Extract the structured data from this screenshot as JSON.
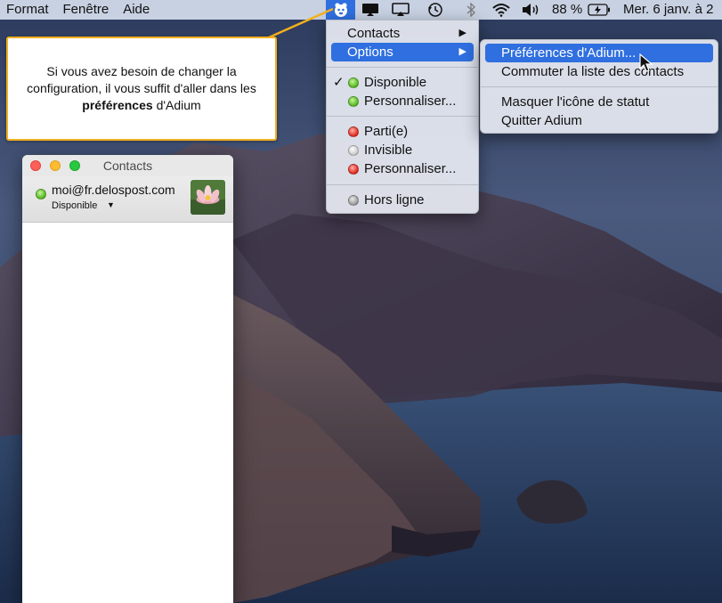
{
  "menubar": {
    "left_items": [
      "Format",
      "Fenêtre",
      "Aide"
    ],
    "battery": "88 %",
    "clock": "Mer. 6 janv. à 2",
    "icons": [
      "adium-icon",
      "display-icon",
      "airplay-icon",
      "time-machine-icon",
      "bluetooth-icon",
      "wifi-icon",
      "volume-icon",
      "battery-charging-icon"
    ]
  },
  "adium_menu": {
    "contacts_label": "Contacts",
    "options_label": "Options",
    "available_label": "Disponible",
    "custom_available_label": "Personnaliser...",
    "away_label": "Parti(e)",
    "invisible_label": "Invisible",
    "custom_away_label": "Personnaliser...",
    "offline_label": "Hors ligne"
  },
  "options_submenu": {
    "preferences_label": "Préférences d'Adium...",
    "toggle_contacts_label": "Commuter la liste des contacts",
    "hide_status_icon_label": "Masquer l'icône de statut",
    "quit_label": "Quitter Adium"
  },
  "callout": {
    "text_before": "Si vous avez besoin de changer la configuration, il vous suffit d'aller dans les",
    "bold_text": "préférences",
    "text_after": "d'Adium"
  },
  "contacts_window": {
    "title": "Contacts",
    "account": "moi@fr.delospost.com",
    "status": "Disponible"
  },
  "colors": {
    "menu_highlight": "#2f6fe0",
    "callout_border": "#f2b01e"
  }
}
